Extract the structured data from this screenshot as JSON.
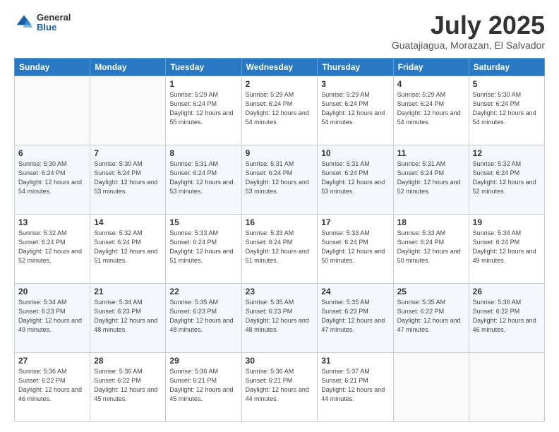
{
  "header": {
    "logo": {
      "general": "General",
      "blue": "Blue"
    },
    "title": "July 2025",
    "subtitle": "Guatajiagua, Morazan, El Salvador"
  },
  "calendar": {
    "days_of_week": [
      "Sunday",
      "Monday",
      "Tuesday",
      "Wednesday",
      "Thursday",
      "Friday",
      "Saturday"
    ],
    "weeks": [
      [
        {
          "day": "",
          "info": ""
        },
        {
          "day": "",
          "info": ""
        },
        {
          "day": "1",
          "info": "Sunrise: 5:29 AM\nSunset: 6:24 PM\nDaylight: 12 hours and 55 minutes."
        },
        {
          "day": "2",
          "info": "Sunrise: 5:29 AM\nSunset: 6:24 PM\nDaylight: 12 hours and 54 minutes."
        },
        {
          "day": "3",
          "info": "Sunrise: 5:29 AM\nSunset: 6:24 PM\nDaylight: 12 hours and 54 minutes."
        },
        {
          "day": "4",
          "info": "Sunrise: 5:29 AM\nSunset: 6:24 PM\nDaylight: 12 hours and 54 minutes."
        },
        {
          "day": "5",
          "info": "Sunrise: 5:30 AM\nSunset: 6:24 PM\nDaylight: 12 hours and 54 minutes."
        }
      ],
      [
        {
          "day": "6",
          "info": "Sunrise: 5:30 AM\nSunset: 6:24 PM\nDaylight: 12 hours and 54 minutes."
        },
        {
          "day": "7",
          "info": "Sunrise: 5:30 AM\nSunset: 6:24 PM\nDaylight: 12 hours and 53 minutes."
        },
        {
          "day": "8",
          "info": "Sunrise: 5:31 AM\nSunset: 6:24 PM\nDaylight: 12 hours and 53 minutes."
        },
        {
          "day": "9",
          "info": "Sunrise: 5:31 AM\nSunset: 6:24 PM\nDaylight: 12 hours and 53 minutes."
        },
        {
          "day": "10",
          "info": "Sunrise: 5:31 AM\nSunset: 6:24 PM\nDaylight: 12 hours and 53 minutes."
        },
        {
          "day": "11",
          "info": "Sunrise: 5:31 AM\nSunset: 6:24 PM\nDaylight: 12 hours and 52 minutes."
        },
        {
          "day": "12",
          "info": "Sunrise: 5:32 AM\nSunset: 6:24 PM\nDaylight: 12 hours and 52 minutes."
        }
      ],
      [
        {
          "day": "13",
          "info": "Sunrise: 5:32 AM\nSunset: 6:24 PM\nDaylight: 12 hours and 52 minutes."
        },
        {
          "day": "14",
          "info": "Sunrise: 5:32 AM\nSunset: 6:24 PM\nDaylight: 12 hours and 51 minutes."
        },
        {
          "day": "15",
          "info": "Sunrise: 5:33 AM\nSunset: 6:24 PM\nDaylight: 12 hours and 51 minutes."
        },
        {
          "day": "16",
          "info": "Sunrise: 5:33 AM\nSunset: 6:24 PM\nDaylight: 12 hours and 51 minutes."
        },
        {
          "day": "17",
          "info": "Sunrise: 5:33 AM\nSunset: 6:24 PM\nDaylight: 12 hours and 50 minutes."
        },
        {
          "day": "18",
          "info": "Sunrise: 5:33 AM\nSunset: 6:24 PM\nDaylight: 12 hours and 50 minutes."
        },
        {
          "day": "19",
          "info": "Sunrise: 5:34 AM\nSunset: 6:24 PM\nDaylight: 12 hours and 49 minutes."
        }
      ],
      [
        {
          "day": "20",
          "info": "Sunrise: 5:34 AM\nSunset: 6:23 PM\nDaylight: 12 hours and 49 minutes."
        },
        {
          "day": "21",
          "info": "Sunrise: 5:34 AM\nSunset: 6:23 PM\nDaylight: 12 hours and 48 minutes."
        },
        {
          "day": "22",
          "info": "Sunrise: 5:35 AM\nSunset: 6:23 PM\nDaylight: 12 hours and 48 minutes."
        },
        {
          "day": "23",
          "info": "Sunrise: 5:35 AM\nSunset: 6:23 PM\nDaylight: 12 hours and 48 minutes."
        },
        {
          "day": "24",
          "info": "Sunrise: 5:35 AM\nSunset: 6:23 PM\nDaylight: 12 hours and 47 minutes."
        },
        {
          "day": "25",
          "info": "Sunrise: 5:35 AM\nSunset: 6:22 PM\nDaylight: 12 hours and 47 minutes."
        },
        {
          "day": "26",
          "info": "Sunrise: 5:36 AM\nSunset: 6:22 PM\nDaylight: 12 hours and 46 minutes."
        }
      ],
      [
        {
          "day": "27",
          "info": "Sunrise: 5:36 AM\nSunset: 6:22 PM\nDaylight: 12 hours and 46 minutes."
        },
        {
          "day": "28",
          "info": "Sunrise: 5:36 AM\nSunset: 6:22 PM\nDaylight: 12 hours and 45 minutes."
        },
        {
          "day": "29",
          "info": "Sunrise: 5:36 AM\nSunset: 6:21 PM\nDaylight: 12 hours and 45 minutes."
        },
        {
          "day": "30",
          "info": "Sunrise: 5:36 AM\nSunset: 6:21 PM\nDaylight: 12 hours and 44 minutes."
        },
        {
          "day": "31",
          "info": "Sunrise: 5:37 AM\nSunset: 6:21 PM\nDaylight: 12 hours and 44 minutes."
        },
        {
          "day": "",
          "info": ""
        },
        {
          "day": "",
          "info": ""
        }
      ]
    ]
  }
}
